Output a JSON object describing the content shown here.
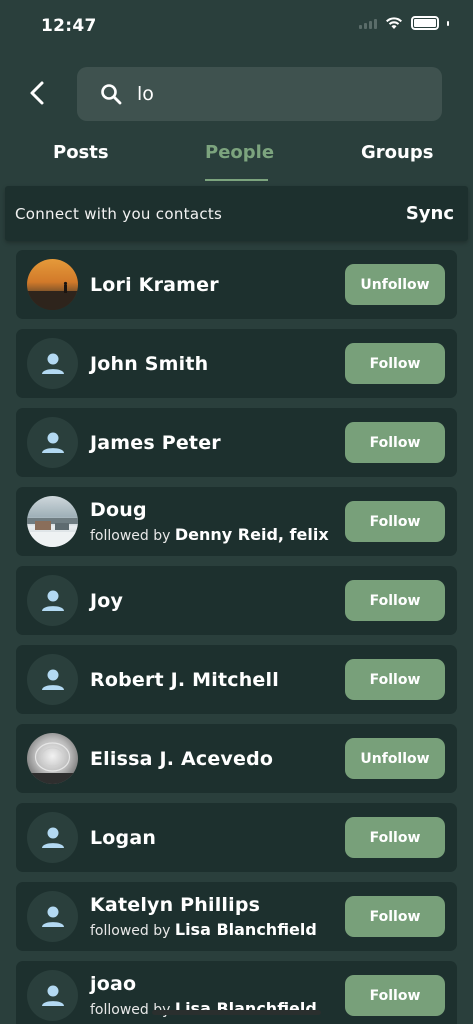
{
  "status": {
    "time": "12:47"
  },
  "search": {
    "value": "lo"
  },
  "tabs": [
    {
      "label": "Posts"
    },
    {
      "label": "People"
    },
    {
      "label": "Groups"
    }
  ],
  "banner": {
    "text": "Connect with you contacts",
    "action": "Sync"
  },
  "people": [
    {
      "name": "Lori Kramer",
      "button": "Unfollow",
      "avatar": "sunset-photo"
    },
    {
      "name": "John Smith",
      "button": "Follow",
      "avatar": "person-icon"
    },
    {
      "name": "James Peter",
      "button": "Follow",
      "avatar": "person-icon"
    },
    {
      "name": "Doug",
      "followed_prefix": "followed by",
      "followed_names": "Denny Reid, felix",
      "button": "Follow",
      "avatar": "snow-photo"
    },
    {
      "name": "Joy",
      "button": "Follow",
      "avatar": "person-icon"
    },
    {
      "name": "Robert J. Mitchell",
      "button": "Follow",
      "avatar": "person-icon"
    },
    {
      "name": "Elissa J. Acevedo",
      "button": "Unfollow",
      "avatar": "glass-photo"
    },
    {
      "name": "Logan",
      "button": "Follow",
      "avatar": "person-icon"
    },
    {
      "name": "Katelyn Phillips",
      "followed_prefix": "followed by",
      "followed_names": "Lisa Blanchfield",
      "button": "Follow",
      "avatar": "person-icon"
    },
    {
      "name": "joao",
      "followed_prefix": "followed by",
      "followed_names": "Lisa Blanchfield",
      "button": "Follow",
      "avatar": "person-icon"
    }
  ],
  "colors": {
    "background": "#2a3f3c",
    "card": "#1d302e",
    "accent": "#7ca47e",
    "button": "#78a07a",
    "person_icon": "#b3d9f2"
  }
}
